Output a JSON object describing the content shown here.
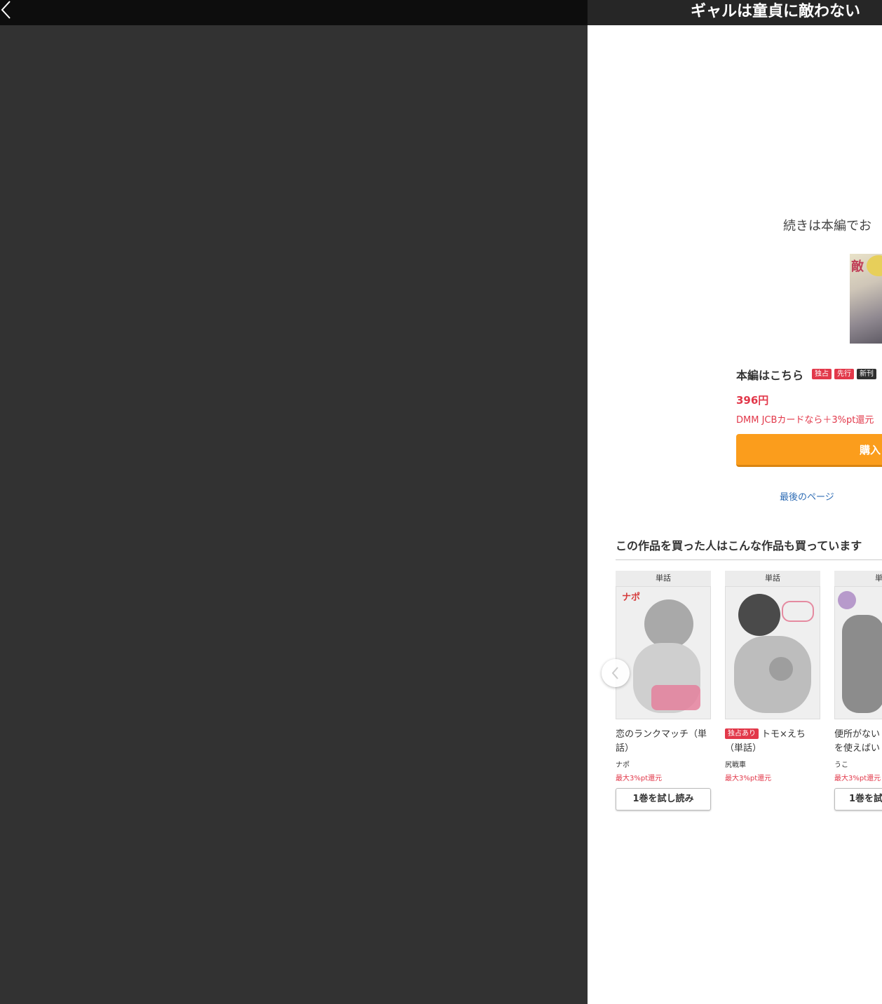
{
  "header": {
    "title": "ギャルは童貞に敵わない"
  },
  "viewer": {
    "continue_text": "続きは本編でお",
    "cover_char": "敵"
  },
  "purchase": {
    "main_label": "本編はこちら",
    "badges": [
      "独占",
      "先行",
      "新刊"
    ],
    "price": "396円",
    "point_note": "DMM JCBカードなら＋3%pt還元",
    "buy_label": "購入",
    "last_page_link": "最後のページ"
  },
  "recommendations": {
    "title": "この作品を買った人はこんな作品も買っています",
    "items": [
      {
        "tag": "単話",
        "name": "恋のランクマッチ（単話）",
        "exclusive": "",
        "author": "ナポ",
        "point": "最大3%pt還元",
        "trial": "1巻を試し読み",
        "cover_text": "ナポ"
      },
      {
        "tag": "単話",
        "name": "トモ×えち（単話）",
        "exclusive": "独占あり",
        "author": "尻戦車",
        "point": "最大3%pt還元",
        "trial": "",
        "cover_text": ""
      },
      {
        "tag": "単",
        "name": "便所がないを使えばい",
        "exclusive": "",
        "author": "うこ",
        "point": "最大3%pt還元",
        "trial": "1巻を試",
        "cover_text": ""
      }
    ]
  }
}
